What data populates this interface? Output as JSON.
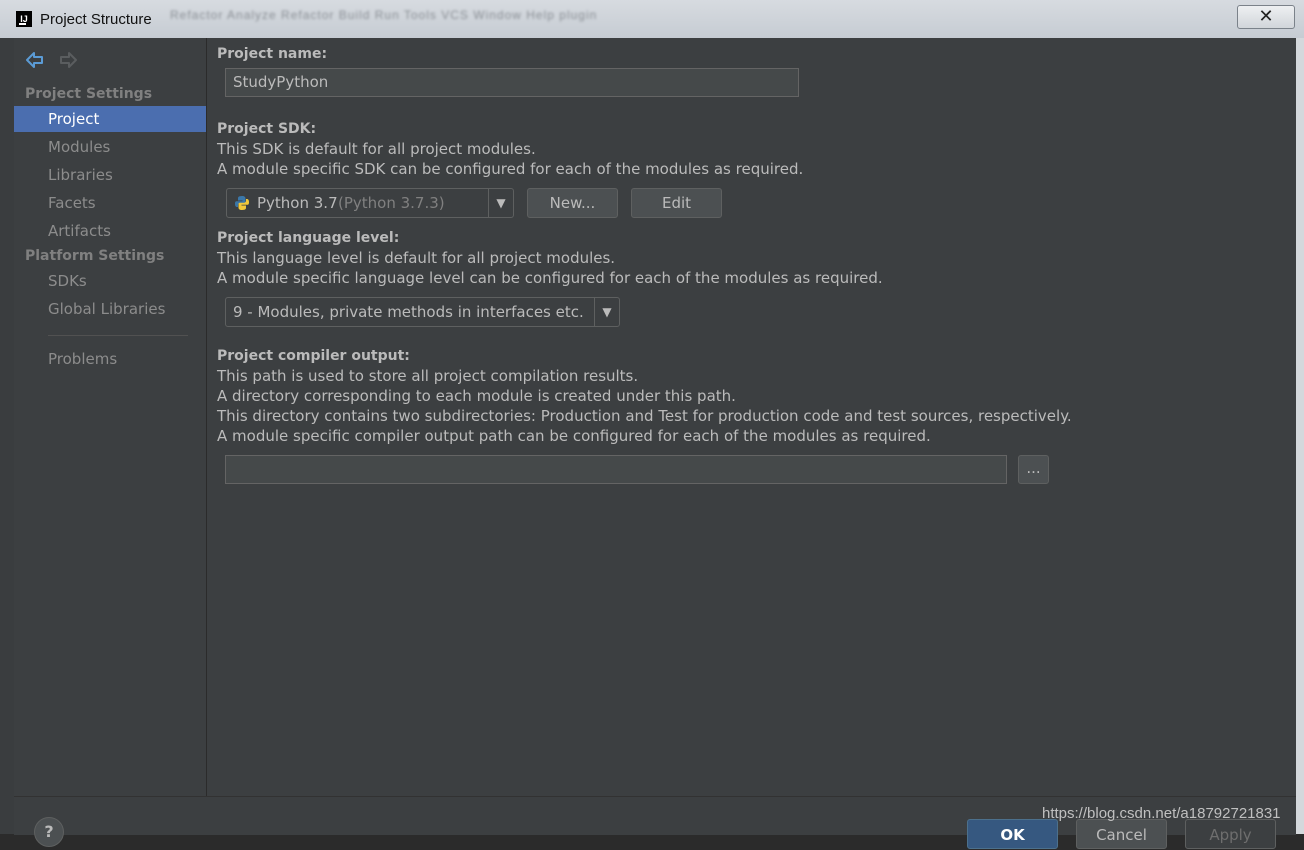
{
  "window": {
    "title": "Project Structure",
    "close_label": "✕",
    "background_menu": "Refactor  Analyze  Refactor  Build  Run  Tools  VCS  Window  Help  plugin"
  },
  "sidebar": {
    "back_icon": "back-arrow-icon",
    "forward_icon": "forward-arrow-icon",
    "project_settings_header": "Project Settings",
    "project_settings_items": [
      {
        "label": "Project",
        "selected": true
      },
      {
        "label": "Modules",
        "selected": false
      },
      {
        "label": "Libraries",
        "selected": false
      },
      {
        "label": "Facets",
        "selected": false
      },
      {
        "label": "Artifacts",
        "selected": false
      }
    ],
    "platform_settings_header": "Platform Settings",
    "platform_settings_items": [
      {
        "label": "SDKs"
      },
      {
        "label": "Global Libraries"
      }
    ],
    "problems_label": "Problems"
  },
  "main": {
    "project_name": {
      "label": "Project name:",
      "value": "StudyPython"
    },
    "project_sdk": {
      "label": "Project SDK:",
      "desc1": "This SDK is default for all project modules.",
      "desc2": "A module specific SDK can be configured for each of the modules as required.",
      "selected_name": "Python 3.7",
      "selected_detail": "(Python 3.7.3)",
      "new_button": "New...",
      "edit_button": "Edit"
    },
    "language_level": {
      "label": "Project language level:",
      "desc1": "This language level is default for all project modules.",
      "desc2": "A module specific language level can be configured for each of the modules as required.",
      "selected": "9 - Modules, private methods in interfaces etc."
    },
    "compiler_output": {
      "label": "Project compiler output:",
      "desc1": "This path is used to store all project compilation results.",
      "desc2": "A directory corresponding to each module is created under this path.",
      "desc3": "This directory contains two subdirectories: Production and Test for production code and test sources, respectively.",
      "desc4": "A module specific compiler output path can be configured for each of the modules as required.",
      "value": "",
      "browse_button": "..."
    }
  },
  "footer": {
    "help_label": "?",
    "ok_label": "OK",
    "cancel_label": "Cancel",
    "apply_label": "Apply"
  },
  "watermark": "https://blog.csdn.net/a18792721831",
  "colors": {
    "dialog_bg": "#3c3f41",
    "selection": "#4b6eaf",
    "field_bg": "#45494a",
    "text": "#bbbbbb"
  }
}
